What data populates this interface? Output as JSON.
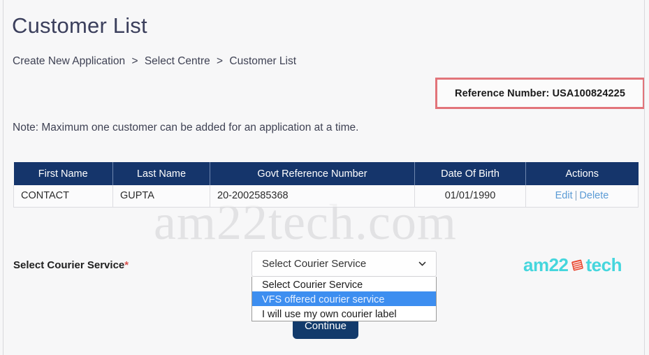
{
  "page": {
    "title": "Customer List"
  },
  "breadcrumb": {
    "separator": ">",
    "items": [
      "Create New Application",
      "Select Centre",
      "Customer List"
    ]
  },
  "reference": {
    "text": "Reference Number: USA100824225",
    "border_color": "#e2747a"
  },
  "note": {
    "text": "Note: Maximum one customer can be added for an application at a time."
  },
  "watermark": {
    "text": "am22tech.com"
  },
  "table": {
    "headers": [
      "First Name",
      "Last Name",
      "Govt Reference Number",
      "Date Of Birth",
      "Actions"
    ],
    "header_bg": "#15356b",
    "rows": [
      {
        "first_name": "CONTACT",
        "last_name": "GUPTA",
        "govt_reference_number": "20-2002585368",
        "date_of_birth": "01/01/1990",
        "actions": {
          "edit": "Edit",
          "separator": "|",
          "delete": "Delete",
          "link_color": "#5b9bd5"
        }
      }
    ]
  },
  "courier": {
    "label": "Select Courier Service",
    "required_marker": "*",
    "select": {
      "value": "Select Courier Service",
      "expanded": true,
      "highlight_color": "#3d8ef0",
      "options": [
        {
          "label": "Select Courier Service",
          "selected": false
        },
        {
          "label": "VFS offered courier service",
          "selected": true
        },
        {
          "label": "I will use my own courier label",
          "selected": false
        }
      ]
    }
  },
  "actions": {
    "continue_label": "Continue",
    "continue_color": "#123a6b"
  },
  "logo": {
    "text_left": "am22",
    "text_right": "tech",
    "color": "#45d6dd",
    "mark_color": "#e8452f"
  }
}
